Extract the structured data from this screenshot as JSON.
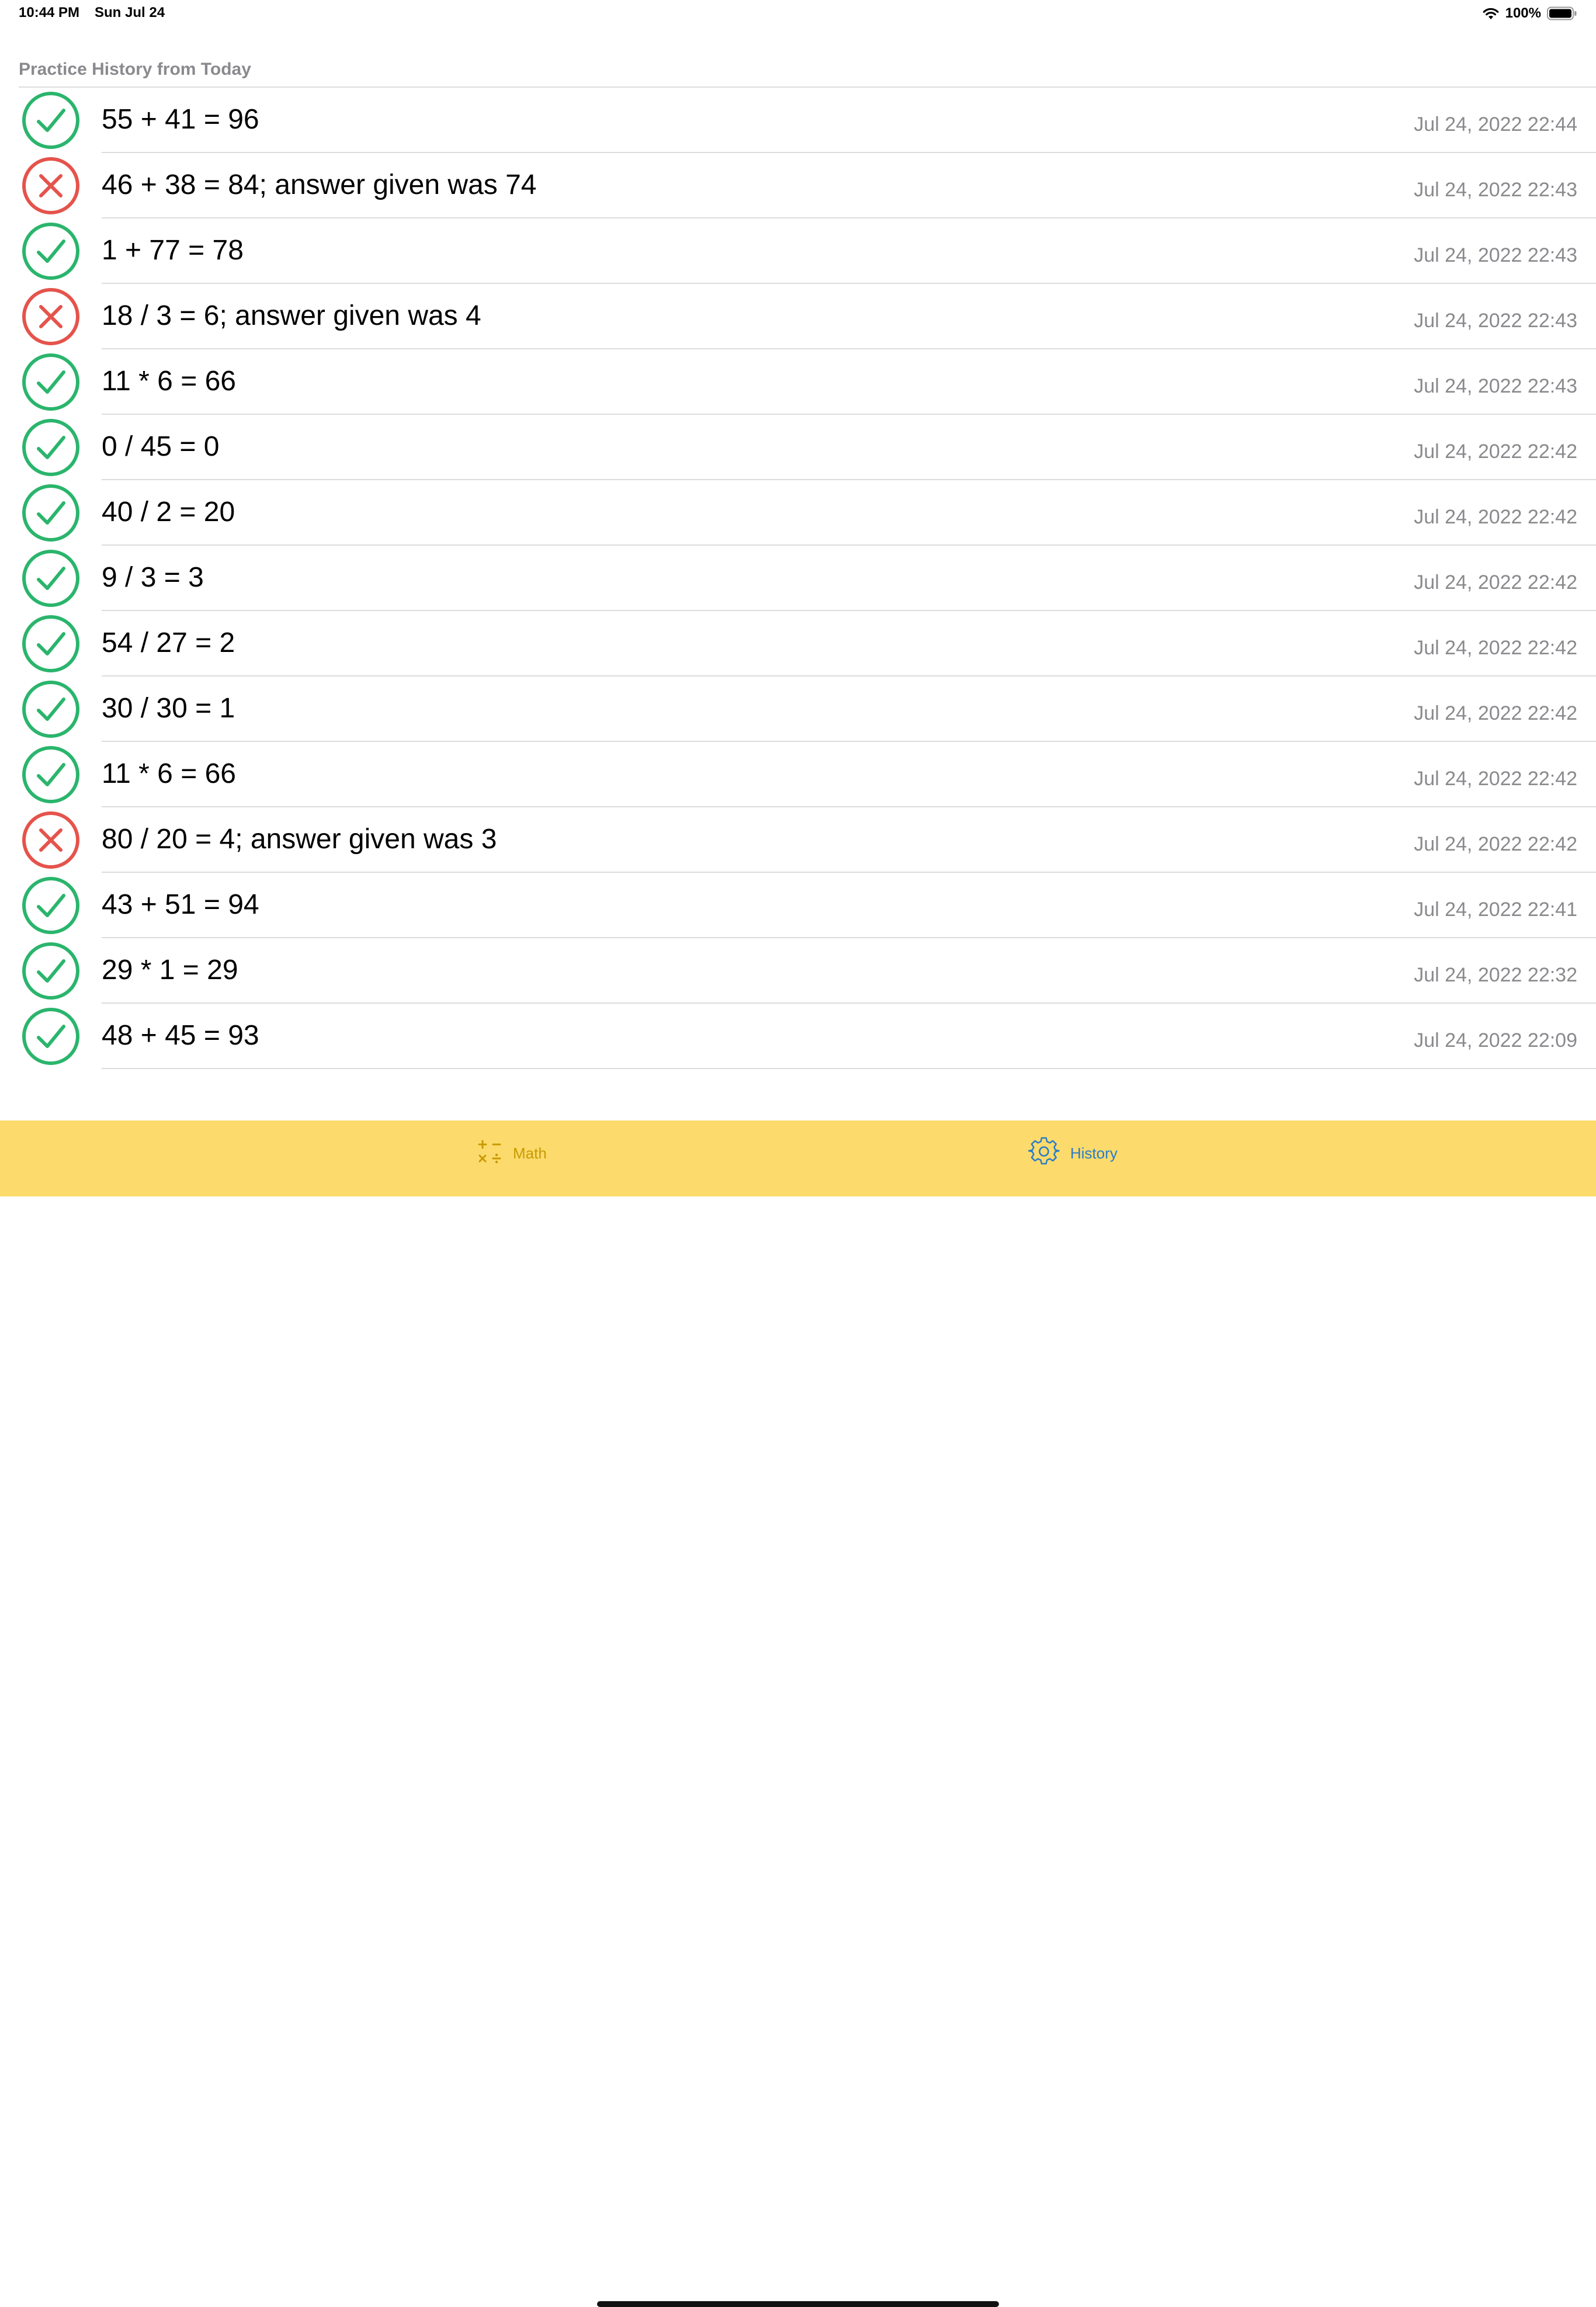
{
  "status_bar": {
    "time": "10:44 PM",
    "date": "Sun Jul 24",
    "battery_percent": "100%",
    "wifi_icon": "wifi-icon",
    "battery_icon": "battery-full-icon"
  },
  "history": {
    "header": "Practice History from Today",
    "items": [
      {
        "status": "correct",
        "text": "55 + 41 = 96",
        "date": "Jul 24, 2022 22:44"
      },
      {
        "status": "incorrect",
        "text": "46 + 38 = 84; answer given was 74",
        "date": "Jul 24, 2022 22:43"
      },
      {
        "status": "correct",
        "text": "1 + 77 = 78",
        "date": "Jul 24, 2022 22:43"
      },
      {
        "status": "incorrect",
        "text": "18 / 3 = 6; answer given was 4",
        "date": "Jul 24, 2022 22:43"
      },
      {
        "status": "correct",
        "text": "11 * 6 = 66",
        "date": "Jul 24, 2022 22:43"
      },
      {
        "status": "correct",
        "text": "0 / 45 = 0",
        "date": "Jul 24, 2022 22:42"
      },
      {
        "status": "correct",
        "text": "40 / 2 = 20",
        "date": "Jul 24, 2022 22:42"
      },
      {
        "status": "correct",
        "text": "9 / 3 = 3",
        "date": "Jul 24, 2022 22:42"
      },
      {
        "status": "correct",
        "text": "54 / 27 = 2",
        "date": "Jul 24, 2022 22:42"
      },
      {
        "status": "correct",
        "text": "30 / 30 = 1",
        "date": "Jul 24, 2022 22:42"
      },
      {
        "status": "correct",
        "text": "11 * 6 = 66",
        "date": "Jul 24, 2022 22:42"
      },
      {
        "status": "incorrect",
        "text": "80 / 20 = 4; answer given was 3",
        "date": "Jul 24, 2022 22:42"
      },
      {
        "status": "correct",
        "text": "43 + 51 = 94",
        "date": "Jul 24, 2022 22:41"
      },
      {
        "status": "correct",
        "text": "29 * 1 = 29",
        "date": "Jul 24, 2022 22:32"
      },
      {
        "status": "correct",
        "text": "48 + 45 = 93",
        "date": "Jul 24, 2022 22:09"
      }
    ]
  },
  "tab_bar": {
    "tabs": [
      {
        "label": "Math",
        "icon": "math-operators-icon",
        "selected": false
      },
      {
        "label": "History",
        "icon": "gear-icon",
        "selected": true
      }
    ]
  },
  "colors": {
    "correct": "#2ab56c",
    "incorrect": "#e5534b",
    "tab_bar_background": "#fcdb6c",
    "tab_selected": "#2a7cc7",
    "tab_unselected": "#c99a00",
    "secondary_text": "#8a8a8e"
  }
}
